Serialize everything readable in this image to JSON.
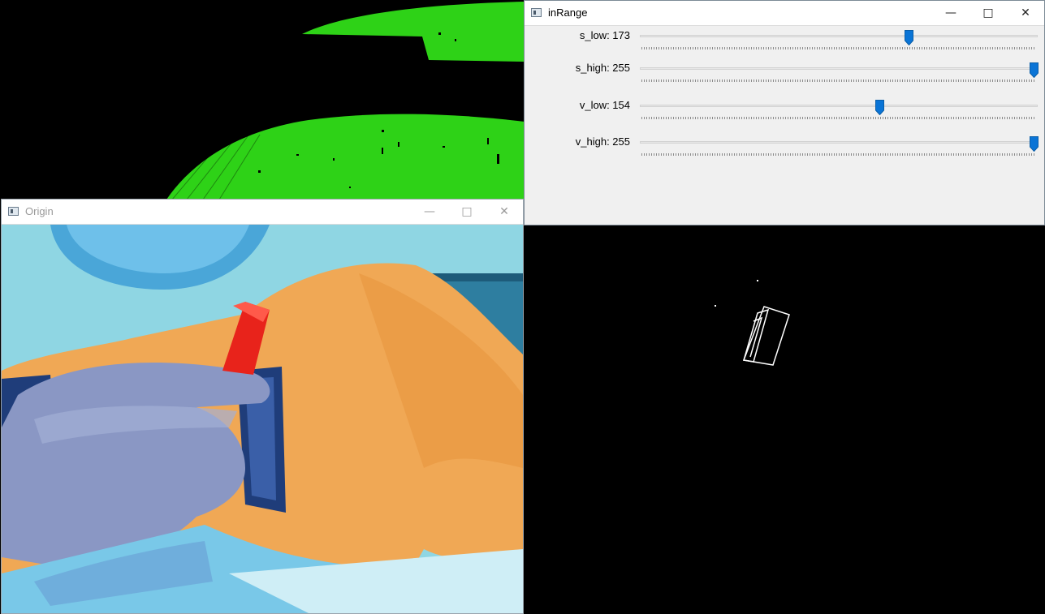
{
  "windows": {
    "origin": {
      "title": "Origin"
    },
    "inrange": {
      "title": "inRange"
    }
  },
  "trackbars": [
    {
      "name": "s_low",
      "label": "s_low: 173",
      "value": 173,
      "max": 255
    },
    {
      "name": "s_high",
      "label": "s_high: 255",
      "value": 255,
      "max": 255
    },
    {
      "name": "v_low",
      "label": "v_low: 154",
      "value": 154,
      "max": 255
    },
    {
      "name": "v_high",
      "label": "v_high: 255",
      "value": 255,
      "max": 255
    }
  ],
  "icons": {
    "minimize": "minimize-icon",
    "maximize": "maximize-icon",
    "close": "close-icon",
    "app": "app-window-icon"
  },
  "colors": {
    "mask_green": "#2ed217",
    "thumb_blue": "#0a74d6",
    "marker_red": "#e8231b",
    "shirt_orange": "#f0a855"
  }
}
